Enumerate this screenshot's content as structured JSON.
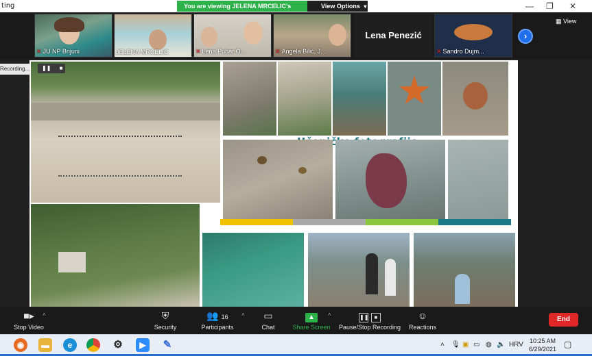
{
  "window": {
    "title": "ting"
  },
  "banner": {
    "viewing": "You are viewing JELENA MRCELIC's screen",
    "view_options": "View Options"
  },
  "window_controls": {
    "minimize": "—",
    "restore": "❐",
    "close": "✕"
  },
  "gallery": {
    "participants": [
      {
        "name": "JU NP Brijuni",
        "muted": true
      },
      {
        "name": "JELENA MRCELIC",
        "muted": false
      },
      {
        "name": "Lena Puhar O...",
        "muted": true
      },
      {
        "name": "Angela Bilić, J...",
        "muted": true
      },
      {
        "name": "Lena Penezić",
        "muted": false,
        "video_off": true
      },
      {
        "name": "Sandro Dujm...",
        "muted": true
      }
    ],
    "next_icon": "chevron-right-icon",
    "view_label": "View"
  },
  "recording": {
    "label": "Recording...",
    "pause": "❚❚",
    "stop": "■"
  },
  "slide": {
    "title": "Učeničke fotografije",
    "bar_colors": [
      "#f2c200",
      "#a9a9a9",
      "#8cc63f",
      "#1b7a88"
    ]
  },
  "toolbar": {
    "stop_video": "Stop Video",
    "security": "Security",
    "participants": "Participants",
    "participants_count": "16",
    "chat": "Chat",
    "share_screen": "Share Screen",
    "pause_stop_recording": "Pause/Stop Recording",
    "reactions": "Reactions",
    "end": "End"
  },
  "taskbar": {
    "apps": [
      "firefox-icon",
      "file-explorer-icon",
      "edge-icon",
      "chrome-icon",
      "settings-icon",
      "zoom-icon",
      "paint-icon"
    ],
    "language": "HRV",
    "time": "10:25 AM",
    "date": "6/29/2021"
  },
  "colors": {
    "accent_green": "#2db24a",
    "end_red": "#e02828",
    "brand_blue": "#1f6feb"
  }
}
